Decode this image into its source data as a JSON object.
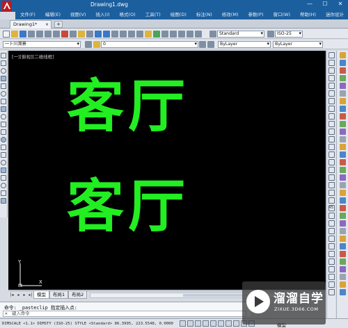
{
  "window": {
    "title": "Drawing1.dwg",
    "controls": [
      "—",
      "☐",
      "✕"
    ]
  },
  "menu": [
    "文件(F)",
    "编辑(E)",
    "视图(V)",
    "插入(I)",
    "格式(O)",
    "工具(T)",
    "绘图(D)",
    "标注(N)",
    "修改(M)",
    "参数(P)",
    "窗口(W)",
    "帮助(H)",
    "迷你设计"
  ],
  "tabs": {
    "active": "Drawing1*",
    "close": "×",
    "new": "+"
  },
  "toolbar1": {
    "text_style": "Standard",
    "dim_style": "ISO-25"
  },
  "toolbar2": {
    "workspace": "一卜川溯景",
    "layer": "0",
    "color": "ByLayer",
    "linetype": "ByLayer"
  },
  "canvas": {
    "view_label": "[一][俯视][二维线框]",
    "text_top": "客厅",
    "text_bottom": "客厅",
    "text_color": "#22ee22",
    "ucs_x": "X",
    "ucs_y": "Y"
  },
  "layout_tabs": [
    "模型",
    "布局1",
    "布局2"
  ],
  "command": {
    "history": "命令: _pasteclip 指定插入点:",
    "prompt": "键入命令"
  },
  "status": {
    "sysvars": "DIMSCALE <1.1> DIMSTY (ISO-25) STYLE <Standard> 86.3995, 223.5548, 0.0000",
    "mode": "模型"
  },
  "watermark": {
    "title": "溜溜自学",
    "subtitle": "ZIXUE.3D66.COM"
  },
  "right_panel_number": "45"
}
